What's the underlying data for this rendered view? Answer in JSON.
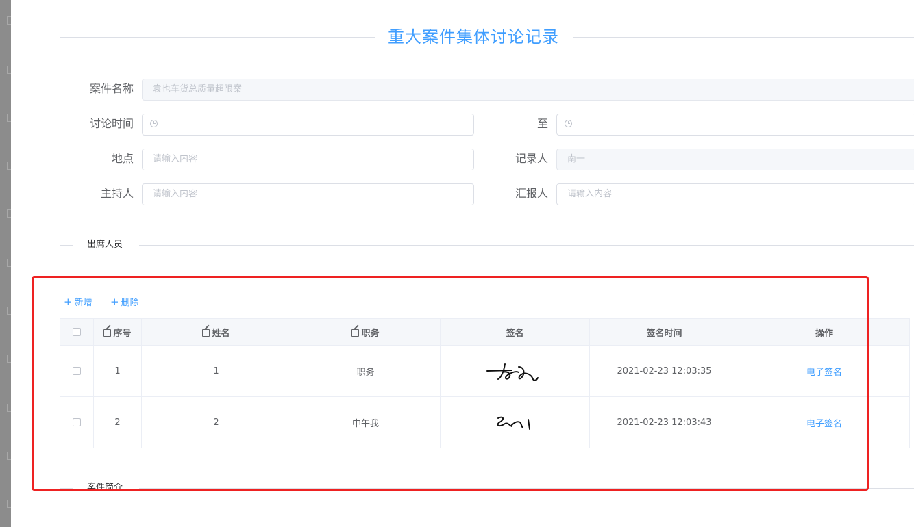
{
  "title": "重大案件集体讨论记录",
  "form": {
    "case_name": {
      "label": "案件名称",
      "value": "袁也车货总质量超限案"
    },
    "discuss_time": {
      "label": "讨论时间",
      "value": ""
    },
    "to": {
      "label": "至",
      "value": ""
    },
    "location": {
      "label": "地点",
      "placeholder": "请输入内容"
    },
    "recorder": {
      "label": "记录人",
      "value": "南一"
    },
    "host": {
      "label": "主持人",
      "placeholder": "请输入内容"
    },
    "reporter": {
      "label": "汇报人",
      "placeholder": "请输入内容"
    }
  },
  "sections": {
    "attendees": "出席人员",
    "case_summary": "案件简介"
  },
  "toolbar": {
    "add_label": "新增",
    "delete_label": "删除"
  },
  "table": {
    "columns": [
      "序号",
      "姓名",
      "职务",
      "签名",
      "签名时间",
      "操作"
    ],
    "rows": [
      {
        "index": "1",
        "name": "1",
        "position": "职务",
        "sign_time": "2021-02-23 12:03:35",
        "action": "电子签名"
      },
      {
        "index": "2",
        "name": "2",
        "position": "中午我",
        "sign_time": "2021-02-23 12:03:43",
        "action": "电子签名"
      }
    ]
  },
  "colors": {
    "accent": "#409eff",
    "highlight": "#ee2222"
  }
}
